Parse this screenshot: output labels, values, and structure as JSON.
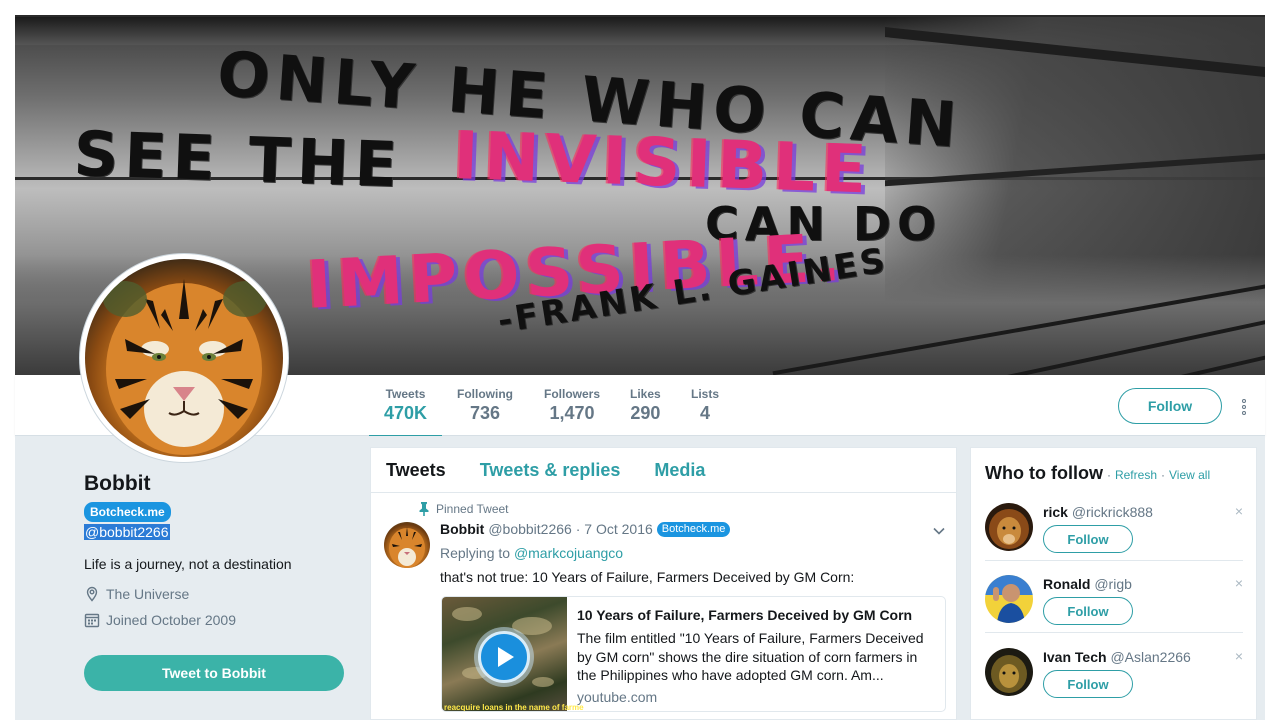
{
  "banner": {
    "quote_line1": "ONLY HE WHO CAN",
    "quote_line2a": "SEE THE",
    "quote_line2b": "INVISIBLE",
    "quote_line3": "CAN DO",
    "quote_line4": "IMPOSSIBLE.",
    "quote_author": "-FRANK L. GAINES"
  },
  "stats": [
    {
      "label": "Tweets",
      "value": "470K"
    },
    {
      "label": "Following",
      "value": "736"
    },
    {
      "label": "Followers",
      "value": "1,470"
    },
    {
      "label": "Likes",
      "value": "290"
    },
    {
      "label": "Lists",
      "value": "4"
    }
  ],
  "header_actions": {
    "follow_label": "Follow"
  },
  "profile": {
    "name": "Bobbit",
    "badge": "Botcheck.me",
    "handle": "@bobbit2266",
    "bio": "Life is a journey, not a destination",
    "location": "The Universe",
    "joined": "Joined October 2009",
    "tweet_to_label": "Tweet to Bobbit"
  },
  "timeline": {
    "tabs": [
      {
        "label": "Tweets"
      },
      {
        "label": "Tweets & replies"
      },
      {
        "label": "Media"
      }
    ],
    "pinned_label": "Pinned Tweet",
    "tweet": {
      "name": "Bobbit",
      "handle_date": "@bobbit2266 · 7 Oct 2016",
      "badge": "Botcheck.me",
      "replying_prefix": "Replying to ",
      "replying_to": "@markcojuangco",
      "text": "that's not true: 10 Years of Failure, Farmers Deceived by GM Corn:",
      "card": {
        "title": "10 Years of Failure, Farmers Deceived by GM Corn",
        "description": "The film entitled \"10 Years of Failure, Farmers Deceived by GM corn\" shows the dire situation of corn farmers in the Philippines who have adopted GM corn. Am...",
        "domain": "youtube.com",
        "thumb_caption": "reacquire loans in the name of farme"
      }
    }
  },
  "who_to_follow": {
    "title": "Who to follow",
    "refresh": "Refresh",
    "view_all": "View all",
    "separator": "·",
    "suggestions": [
      {
        "name": "rick",
        "handle": "@rickrick888",
        "button": "Follow",
        "dismiss": "×"
      },
      {
        "name": "Ronald",
        "handle": "@rigb",
        "button": "Follow",
        "dismiss": "×"
      },
      {
        "name": "Ivan Tech",
        "handle": "@Aslan2266",
        "button": "Follow",
        "dismiss": "×"
      }
    ]
  },
  "colors": {
    "accent": "#2e9ea6",
    "badge": "#1b95e0",
    "tweet_to_bg": "#3bb3a8"
  }
}
